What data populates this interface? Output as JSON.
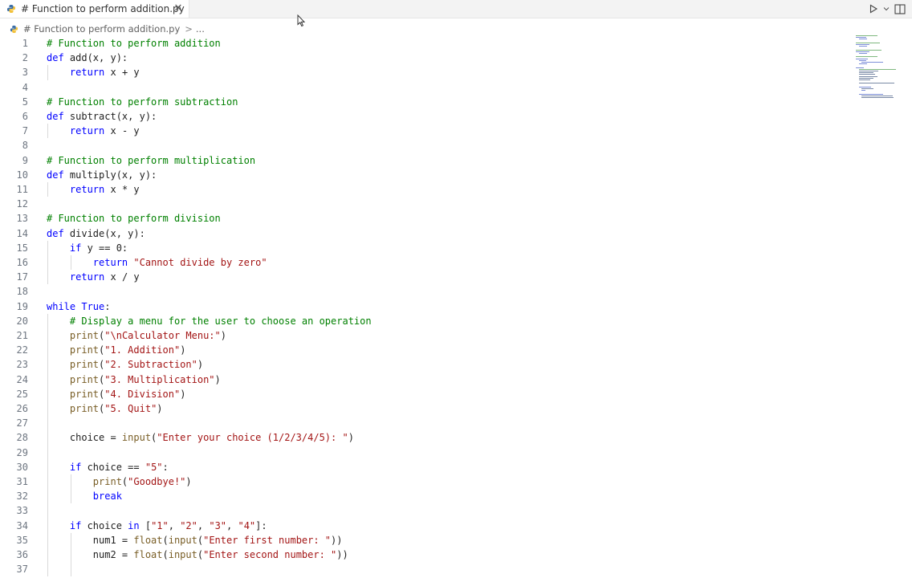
{
  "tab": {
    "title": "# Function to perform addition.py",
    "close_glyph": "✕"
  },
  "breadcrumb": {
    "file": "# Function to perform addition.py",
    "separator": ">",
    "more": "..."
  },
  "colors": {
    "keyword": "#0000ff",
    "comment": "#008000",
    "string": "#a31515",
    "builtin": "#795e26",
    "plain": "#1f1f1f"
  },
  "toolbar": {
    "run_icon": "play-icon",
    "run_menu_icon": "chevron-down-icon",
    "split_icon": "split-editor-icon"
  },
  "lines": [
    "# Function to perform addition",
    "def add(x, y):",
    "    return x + y",
    "",
    "# Function to perform subtraction",
    "def subtract(x, y):",
    "    return x - y",
    "",
    "# Function to perform multiplication",
    "def multiply(x, y):",
    "    return x * y",
    "",
    "# Function to perform division",
    "def divide(x, y):",
    "    if y == 0:",
    "        return \"Cannot divide by zero\"",
    "    return x / y",
    "",
    "while True:",
    "    # Display a menu for the user to choose an operation",
    "    print(\"\\nCalculator Menu:\")",
    "    print(\"1. Addition\")",
    "    print(\"2. Subtraction\")",
    "    print(\"3. Multiplication\")",
    "    print(\"4. Division\")",
    "    print(\"5. Quit\")",
    "",
    "    choice = input(\"Enter your choice (1/2/3/4/5): \")",
    "",
    "    if choice == \"5\":",
    "        print(\"Goodbye!\")",
    "        break",
    "",
    "    if choice in [\"1\", \"2\", \"3\", \"4\"]:",
    "        num1 = float(input(\"Enter first number: \"))",
    "        num2 = float(input(\"Enter second number: \"))",
    ""
  ]
}
